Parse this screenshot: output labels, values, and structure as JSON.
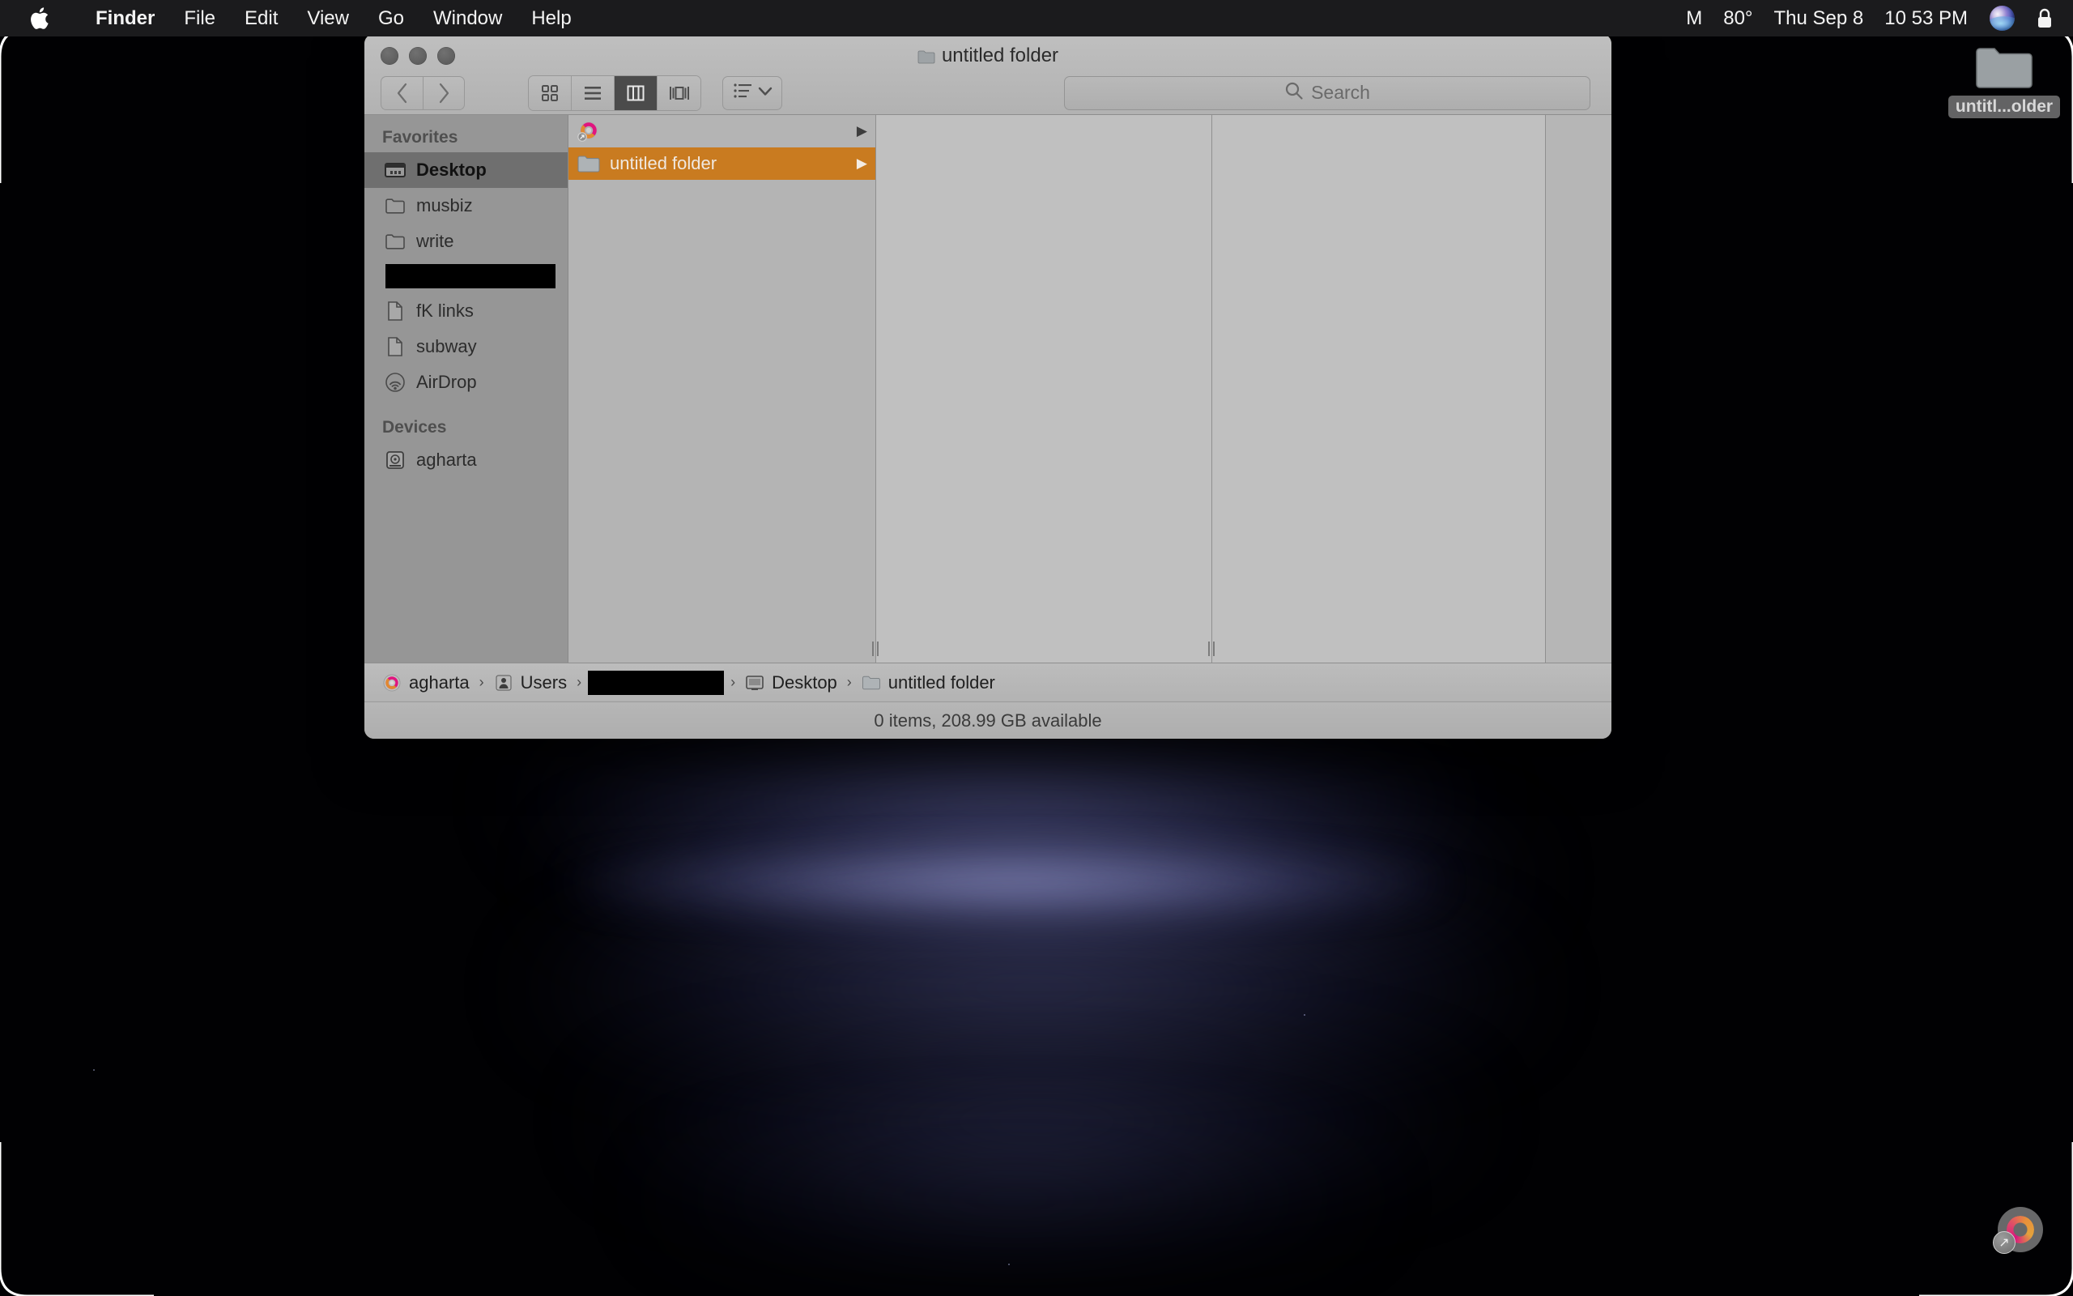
{
  "menubar": {
    "apple_icon": "apple-logo-icon",
    "app_name": "Finder",
    "items": [
      "File",
      "Edit",
      "View",
      "Go",
      "Window",
      "Help"
    ],
    "status": {
      "carrier": "M",
      "temperature": "80°",
      "date": "Thu Sep 8",
      "time": "10 53 PM",
      "siri_icon": "siri-orb-icon",
      "lock_icon": "lock-icon"
    }
  },
  "finder": {
    "title": "untitled folder",
    "title_icon": "folder-icon",
    "traffic_lights": [
      "close-button",
      "minimize-button",
      "zoom-button"
    ],
    "toolbar": {
      "back_icon": "chevron-left-icon",
      "forward_icon": "chevron-right-icon",
      "views": [
        {
          "name": "icon-view",
          "icon": "grid-icon",
          "active": false
        },
        {
          "name": "list-view",
          "icon": "list-icon",
          "active": false
        },
        {
          "name": "column-view",
          "icon": "columns-icon",
          "active": true
        },
        {
          "name": "gallery-view",
          "icon": "gallery-icon",
          "active": false
        }
      ],
      "arrange_icon": "arrange-list-icon",
      "arrange_chevron": "chevron-down-icon"
    },
    "search": {
      "icon": "search-icon",
      "placeholder": "Search",
      "value": ""
    },
    "sidebar": {
      "sections": [
        {
          "header": "Favorites",
          "items": [
            {
              "label": "Desktop",
              "icon": "desktop-icon",
              "selected": true
            },
            {
              "label": "musbiz",
              "icon": "folder-icon",
              "selected": false
            },
            {
              "label": "write",
              "icon": "folder-icon",
              "selected": false
            },
            {
              "label": "",
              "icon": "redacted",
              "selected": false,
              "redacted": true
            },
            {
              "label": "fK links",
              "icon": "document-icon",
              "selected": false
            },
            {
              "label": "subway",
              "icon": "document-icon",
              "selected": false
            },
            {
              "label": "AirDrop",
              "icon": "airdrop-icon",
              "selected": false
            }
          ]
        },
        {
          "header": "Devices",
          "items": [
            {
              "label": "agharta",
              "icon": "harddisk-icon",
              "selected": false
            }
          ]
        }
      ]
    },
    "columns": [
      {
        "name": "column-desktop",
        "rows": [
          {
            "label": "",
            "icon": "disc-alias-icon",
            "selected": false,
            "has_arrow": true
          },
          {
            "label": "untitled folder",
            "icon": "folder-icon",
            "selected": true,
            "has_arrow": true
          }
        ]
      },
      {
        "name": "column-untitled-folder",
        "rows": []
      },
      {
        "name": "column-preview",
        "rows": []
      },
      {
        "name": "column-empty",
        "rows": []
      }
    ],
    "pathbar": [
      {
        "label": "agharta",
        "icon": "disc-icon",
        "redacted": false
      },
      {
        "label": "Users",
        "icon": "users-icon",
        "redacted": false
      },
      {
        "label": "",
        "icon": "",
        "redacted": true
      },
      {
        "label": "Desktop",
        "icon": "desktop-icon",
        "redacted": false
      },
      {
        "label": "untitled folder",
        "icon": "folder-icon",
        "redacted": false
      }
    ],
    "path_separator": "›",
    "statusbar": "0 items, 208.99 GB available"
  },
  "desktop": {
    "icons": [
      {
        "name": "untitled-folder",
        "label": "untitl...older",
        "icon": "folder-icon"
      },
      {
        "name": "disc-alias",
        "label": "",
        "icon": "disc-alias-icon"
      }
    ],
    "wallpaper": "dark aurora bands"
  },
  "colors": {
    "selection_orange": "#c97b20",
    "menubar_bg": "#1b1b1d",
    "window_chrome": "#b4b4b4",
    "sidebar_bg": "#969696",
    "sidebar_selected": "#6f6f6f"
  }
}
